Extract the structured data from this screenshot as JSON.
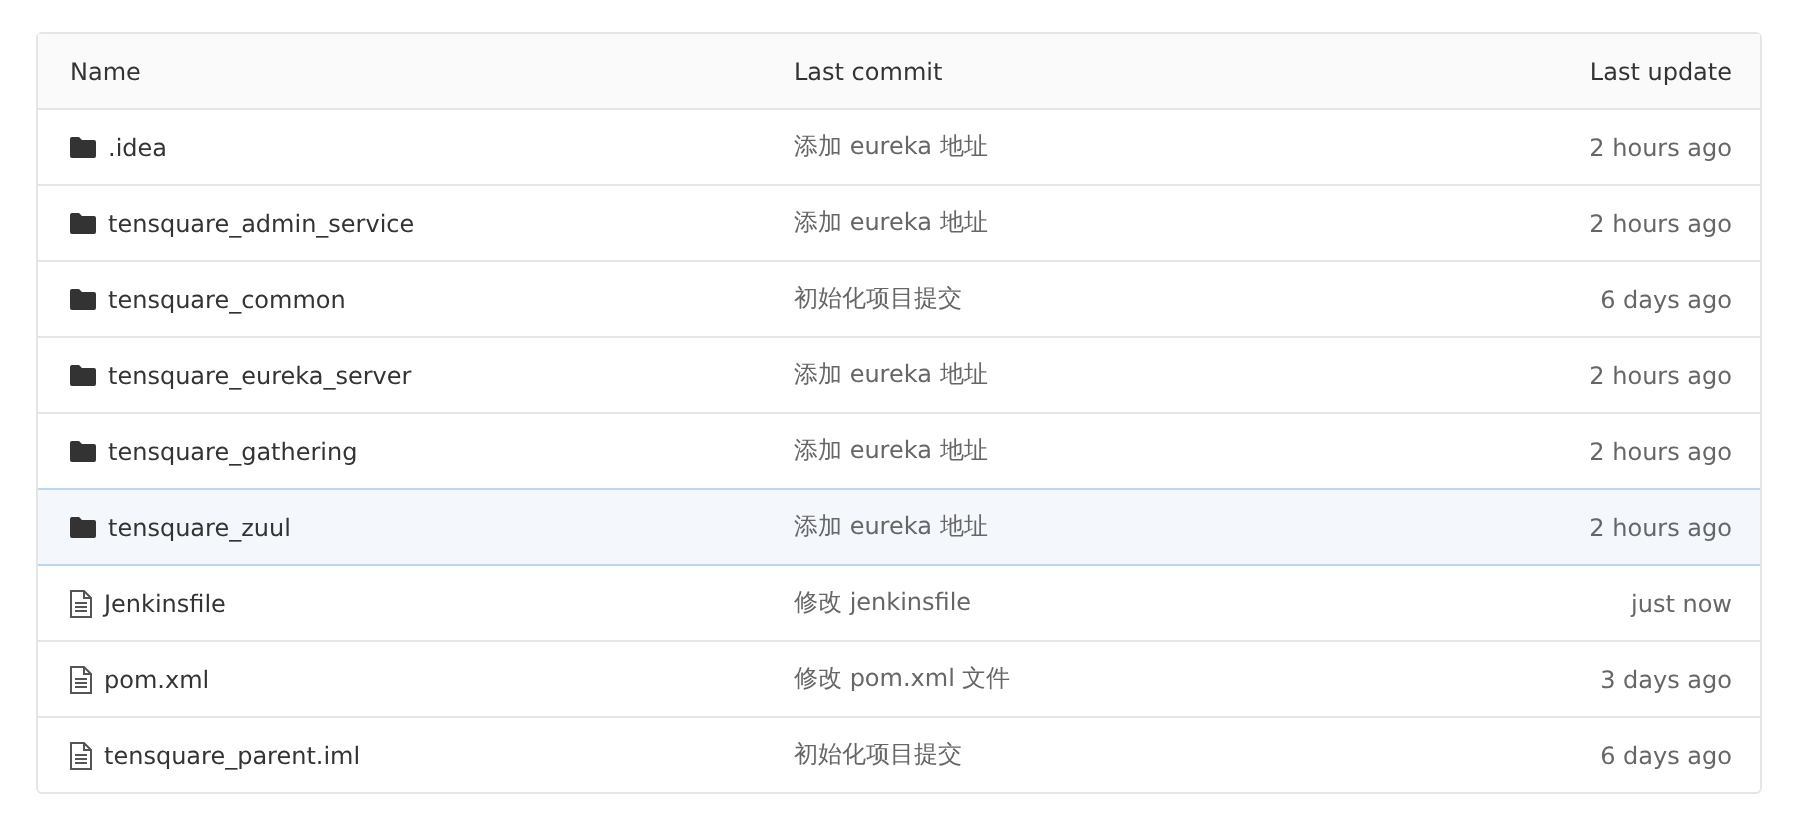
{
  "table": {
    "columns": [
      "Name",
      "Last commit",
      "Last update"
    ],
    "rows": [
      {
        "kind": "folder",
        "name": ".idea",
        "commit": "添加 eureka 地址",
        "updated": "2 hours ago",
        "selected": false
      },
      {
        "kind": "folder",
        "name": "tensquare_admin_service",
        "commit": "添加 eureka 地址",
        "updated": "2 hours ago",
        "selected": false
      },
      {
        "kind": "folder",
        "name": "tensquare_common",
        "commit": "初始化项目提交",
        "updated": "6 days ago",
        "selected": false
      },
      {
        "kind": "folder",
        "name": "tensquare_eureka_server",
        "commit": "添加 eureka 地址",
        "updated": "2 hours ago",
        "selected": false
      },
      {
        "kind": "folder",
        "name": "tensquare_gathering",
        "commit": "添加 eureka 地址",
        "updated": "2 hours ago",
        "selected": false
      },
      {
        "kind": "folder",
        "name": "tensquare_zuul",
        "commit": "添加 eureka 地址",
        "updated": "2 hours ago",
        "selected": true
      },
      {
        "kind": "file",
        "name": "Jenkinsfile",
        "commit": "修改 jenkinsfile",
        "updated": "just now",
        "selected": false
      },
      {
        "kind": "file",
        "name": "pom.xml",
        "commit": "修改 pom.xml 文件",
        "updated": "3 days ago",
        "selected": false
      },
      {
        "kind": "file",
        "name": "tensquare_parent.iml",
        "commit": "初始化项目提交",
        "updated": "6 days ago",
        "selected": false
      }
    ]
  }
}
